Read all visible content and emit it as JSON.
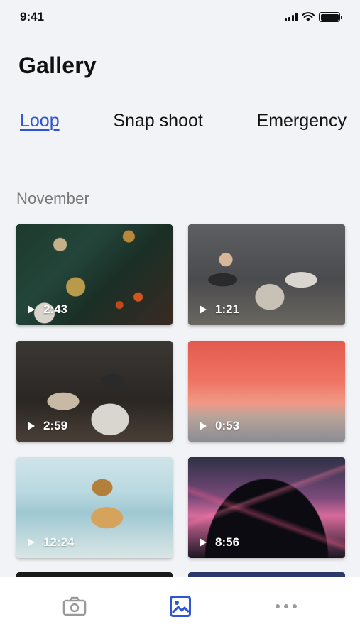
{
  "status_bar": {
    "time": "9:41",
    "icons": [
      "signal-icon",
      "wifi-icon",
      "battery-icon"
    ]
  },
  "page": {
    "title": "Gallery"
  },
  "tabs": [
    {
      "label": "Loop",
      "active": true
    },
    {
      "label": "Snap shoot",
      "active": false
    },
    {
      "label": "Emergency",
      "active": false
    }
  ],
  "section": {
    "title": "November"
  },
  "videos": [
    {
      "duration": "2:43",
      "subject": "Christmas tree with ornaments"
    },
    {
      "duration": "1:21",
      "subject": "Friends laughing on a couch"
    },
    {
      "duration": "2:59",
      "subject": "People in masks at a party"
    },
    {
      "duration": "0:53",
      "subject": "Pink sunset over the sea"
    },
    {
      "duration": "12:24",
      "subject": "Woman with curly hair at the beach"
    },
    {
      "duration": "8:56",
      "subject": "Concert crowd with lasers"
    }
  ],
  "bottom_nav": {
    "items": [
      {
        "icon": "camera-icon",
        "active": false
      },
      {
        "icon": "gallery-icon",
        "active": true
      },
      {
        "icon": "more-icon",
        "active": false
      }
    ]
  },
  "colors": {
    "accent": "#2f55d4",
    "background": "#f2f3f6",
    "inactive_icon": "#9a9a9a"
  }
}
